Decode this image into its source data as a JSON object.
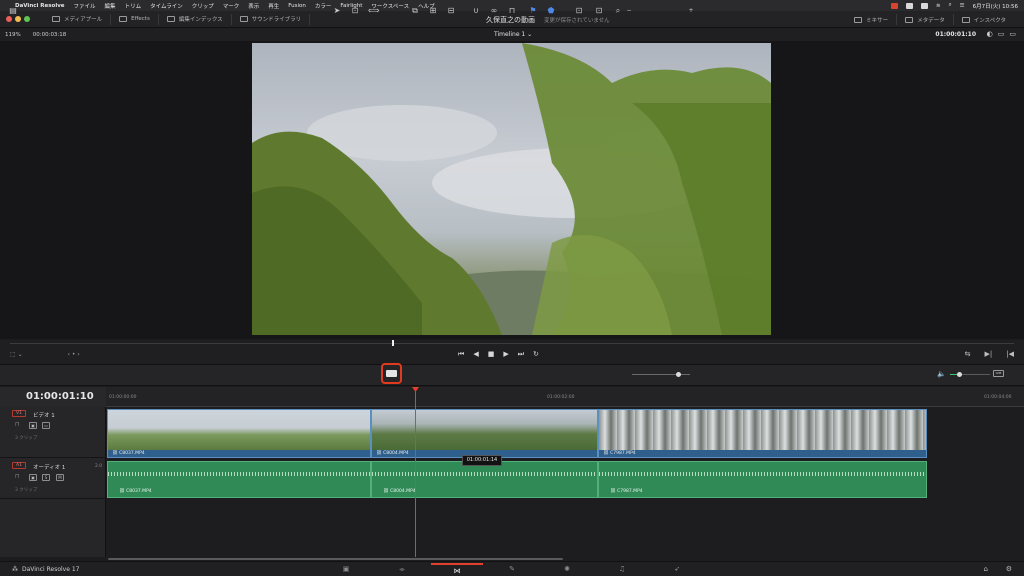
{
  "menubar": {
    "app": "DaVinci Resolve",
    "items": [
      "ファイル",
      "編集",
      "トリム",
      "タイムライン",
      "クリップ",
      "マーク",
      "表示",
      "再生",
      "Fusion",
      "カラー",
      "Fairlight",
      "ワークスペース",
      "ヘルプ"
    ],
    "clock": "6月7日(火) 10:56"
  },
  "topbar": {
    "items": [
      "メディアプール",
      "Effects",
      "編集インデックス",
      "サウンドライブラリ"
    ],
    "project_title": "久保直之の動画",
    "save_status": "変更が保存されていません",
    "right_items": [
      "ミキサー",
      "メタデータ",
      "インスペクタ"
    ]
  },
  "viewer": {
    "zoom": "119%",
    "source_tc": "00:00:03:18",
    "timeline_name": "Timeline 1",
    "record_tc": "01:00:01:10"
  },
  "timeline": {
    "timecode": "01:00:01:10",
    "ruler_ticks": [
      "01:00:00:00",
      "01:00:02:00",
      "01:00:04:00"
    ],
    "tooltip": "01:00:01:14",
    "tracks": {
      "video": {
        "id": "V1",
        "name": "ビデオ 1",
        "count": "3 クリップ"
      },
      "audio": {
        "id": "A1",
        "name": "オーディオ 1",
        "channel": "2.0",
        "count": "3 クリップ",
        "solo": "S",
        "mute": "M"
      }
    },
    "clips": [
      "C8037.MP4",
      "C8004.MP4",
      "C7987.MP4"
    ],
    "volume_meter": "0dB"
  },
  "pagebar": {
    "brand": "DaVinci Resolve 17",
    "active_page": "edit"
  },
  "colors": {
    "video_clip": "#2f5f8c",
    "audio_clip": "#2f8a56",
    "playhead": "#e0402c",
    "highlight": "#e23a1f"
  }
}
